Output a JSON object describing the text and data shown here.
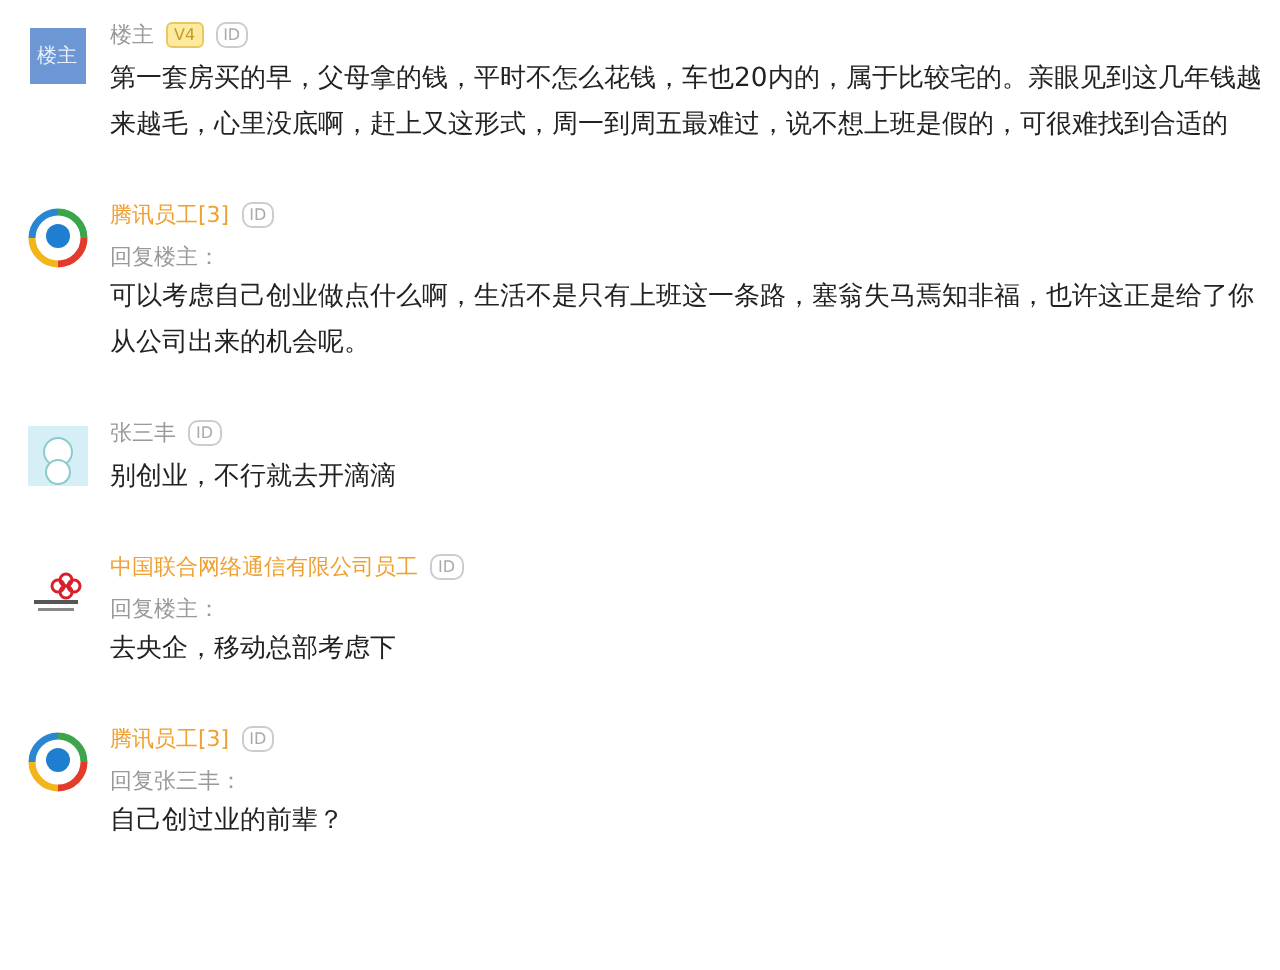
{
  "comments": [
    {
      "avatar": {
        "kind": "text",
        "text": "楼主"
      },
      "name": "楼主",
      "certified": false,
      "badges": [
        {
          "kind": "level",
          "text": "V4"
        },
        {
          "kind": "id",
          "text": "ID"
        }
      ],
      "text": "第一套房买的早，父母拿的钱，平时不怎么花钱，车也20内的，属于比较宅的。亲眼见到这几年钱越来越毛，心里没底啊，赶上又这形式，周一到周五最难过，说不想上班是假的，可很难找到合适的"
    },
    {
      "avatar": {
        "kind": "ring"
      },
      "name": "腾讯员工[3]",
      "certified": true,
      "badges": [
        {
          "kind": "id",
          "text": "ID"
        }
      ],
      "reply_to": "回复楼主：",
      "text": "可以考虑自己创业做点什么啊，生活不是只有上班这一条路，塞翁失马焉知非福，也许这正是给了你从公司出来的机会呢。"
    },
    {
      "avatar": {
        "kind": "snowman"
      },
      "name": "张三丰",
      "certified": false,
      "badges": [
        {
          "kind": "id",
          "text": "ID"
        }
      ],
      "text": "别创业，不行就去开滴滴"
    },
    {
      "avatar": {
        "kind": "knot"
      },
      "name": "中国联合网络通信有限公司员工",
      "certified": true,
      "badges": [
        {
          "kind": "id",
          "text": "ID"
        }
      ],
      "reply_to": "回复楼主：",
      "text": "去央企，移动总部考虑下"
    },
    {
      "avatar": {
        "kind": "ring"
      },
      "name": "腾讯员工[3]",
      "certified": true,
      "badges": [
        {
          "kind": "id",
          "text": "ID"
        }
      ],
      "reply_to": "回复张三丰：",
      "text": "自己创过业的前辈？"
    }
  ]
}
